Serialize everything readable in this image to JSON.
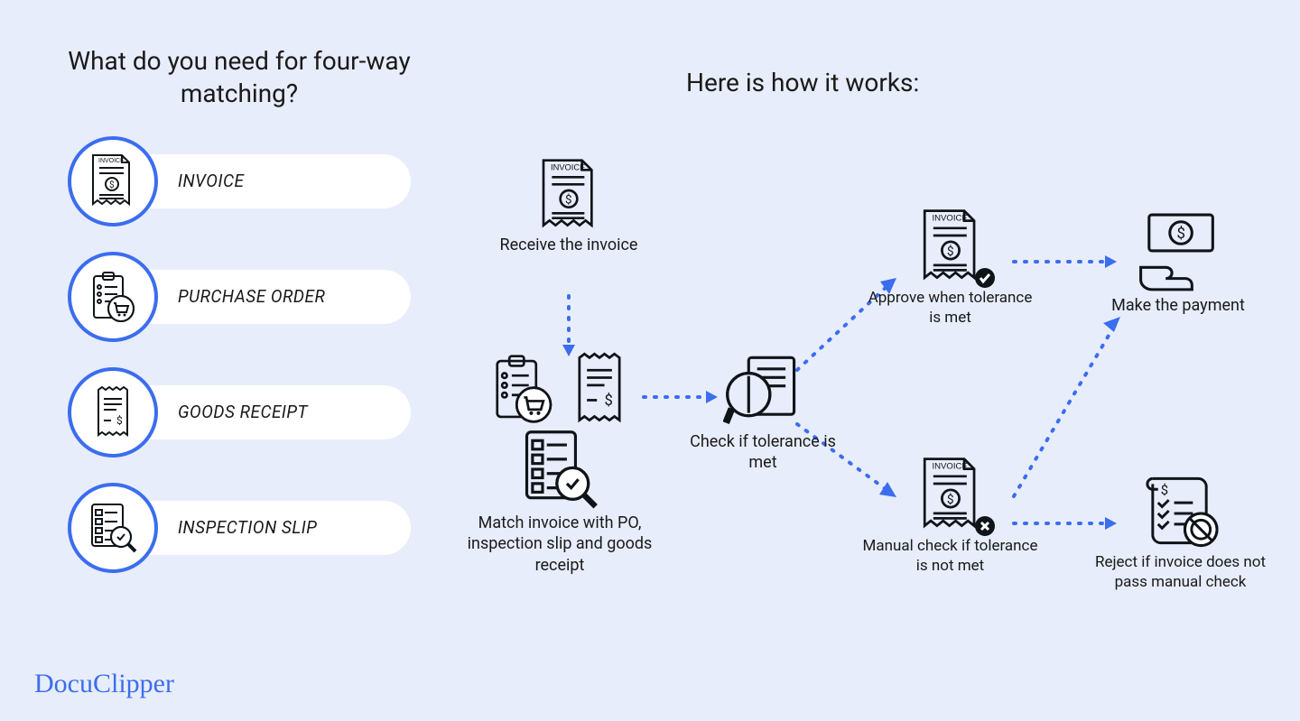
{
  "left": {
    "title": "What do you need for four-way matching?",
    "items": [
      {
        "label": "INVOICE",
        "icon": "invoice-icon"
      },
      {
        "label": "PURCHASE ORDER",
        "icon": "purchase-order-icon"
      },
      {
        "label": "GOODS RECEIPT",
        "icon": "goods-receipt-icon"
      },
      {
        "label": "INSPECTION SLIP",
        "icon": "inspection-slip-icon"
      }
    ]
  },
  "right": {
    "title": "Here is how it works:",
    "steps": {
      "receive": "Receive the invoice",
      "match": "Match invoice with PO, inspection slip and goods receipt",
      "check": "Check if tolerance is met",
      "approve": "Approve when tolerance is met",
      "manual": "Manual check if tolerance is not met",
      "pay": "Make the payment",
      "reject": "Reject if invoice does not pass manual check"
    }
  },
  "brand": "DocuClipper",
  "icon_label": "INVOICE"
}
